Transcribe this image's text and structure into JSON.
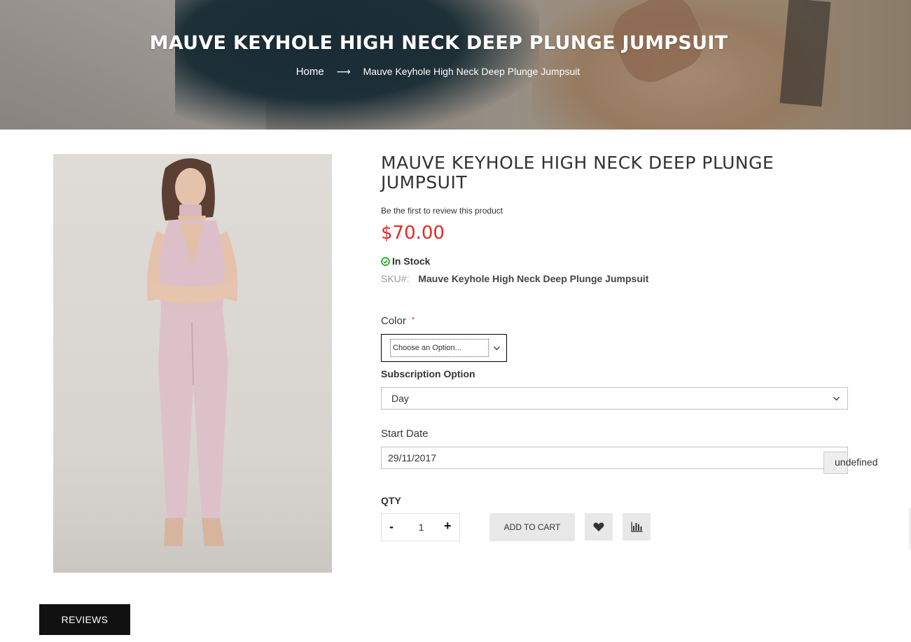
{
  "hero": {
    "title": "MAUVE KEYHOLE HIGH NECK DEEP PLUNGE JUMPSUIT",
    "breadcrumb": {
      "home": "Home",
      "separator": "⟶",
      "current": "Mauve Keyhole High Neck Deep Plunge Jumpsuit"
    }
  },
  "product": {
    "name": "MAUVE KEYHOLE HIGH NECK DEEP PLUNGE JUMPSUIT",
    "review_link": "Be the first to review this product",
    "price": "$70.00",
    "stock": "In Stock",
    "sku_label": "SKU#:",
    "sku_value": "Mauve Keyhole High Neck Deep Plunge Jumpsuit"
  },
  "options": {
    "color_label": "Color",
    "required_mark": "*",
    "color_placeholder": "Choose an Option...",
    "subscription_label": "Subscription Option",
    "subscription_value": "Day",
    "start_date_label": "Start Date",
    "start_date_value": "29/11/2017",
    "date_button_text": "undefined"
  },
  "cart": {
    "qty_label": "QTY",
    "qty_minus": "-",
    "qty_value": "1",
    "qty_plus": "+",
    "add_to_cart": "ADD TO CART"
  },
  "tabs": {
    "reviews": "REVIEWS"
  },
  "colors": {
    "price": "#e02b27",
    "in_stock": "#20a020",
    "tab_active": "#111111"
  }
}
